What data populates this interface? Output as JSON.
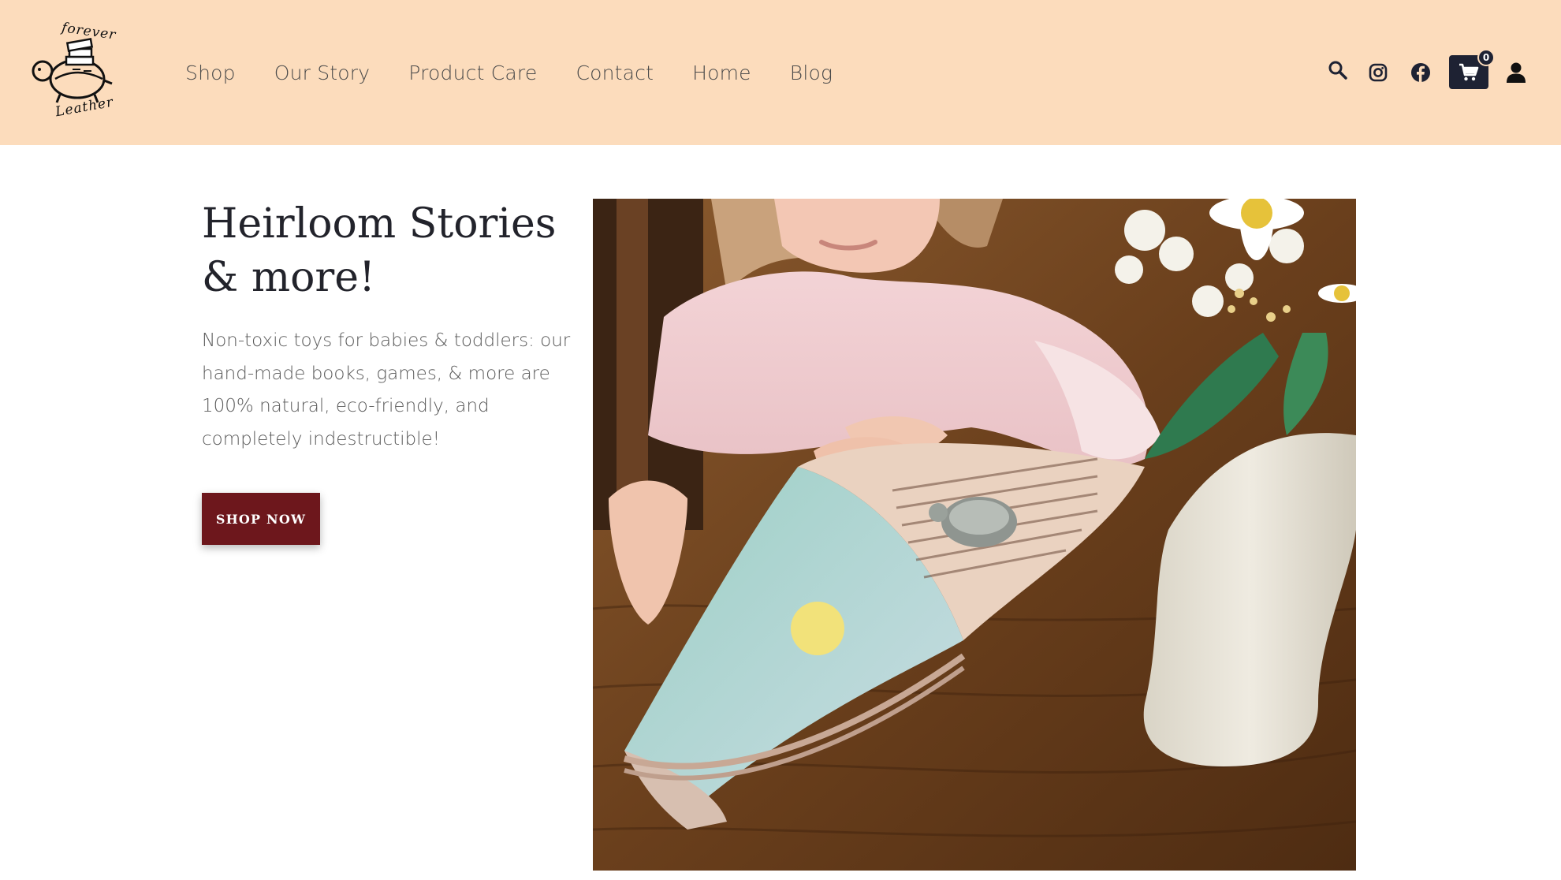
{
  "brand": {
    "logo_top_word": "forever",
    "logo_bottom_word": "Leather",
    "logo_icon": "turtle-with-books-icon"
  },
  "nav": {
    "items": [
      {
        "label": "Shop"
      },
      {
        "label": "Our Story"
      },
      {
        "label": "Product Care"
      },
      {
        "label": "Contact"
      },
      {
        "label": "Home"
      },
      {
        "label": "Blog"
      }
    ]
  },
  "header_icons": {
    "search": "search-icon",
    "instagram": "instagram-icon",
    "facebook": "facebook-icon",
    "cart": "cart-icon",
    "cart_count": "0",
    "account": "account-icon"
  },
  "hero": {
    "title": "Heirloom Stories & more!",
    "description": "Non-toxic toys for babies & toddlers: our hand-made books, games, & more are 100% natural, eco-friendly, and completely indestructible!",
    "cta_label": "SHOP NOW",
    "image_subject": "child reading a leather book with a small turtle figurine beside a vase of daisies"
  },
  "colors": {
    "header_bg": "#fcdcbc",
    "cta_bg": "#6d171c",
    "cart_bg": "#1e2233",
    "title_text": "#22232b"
  }
}
